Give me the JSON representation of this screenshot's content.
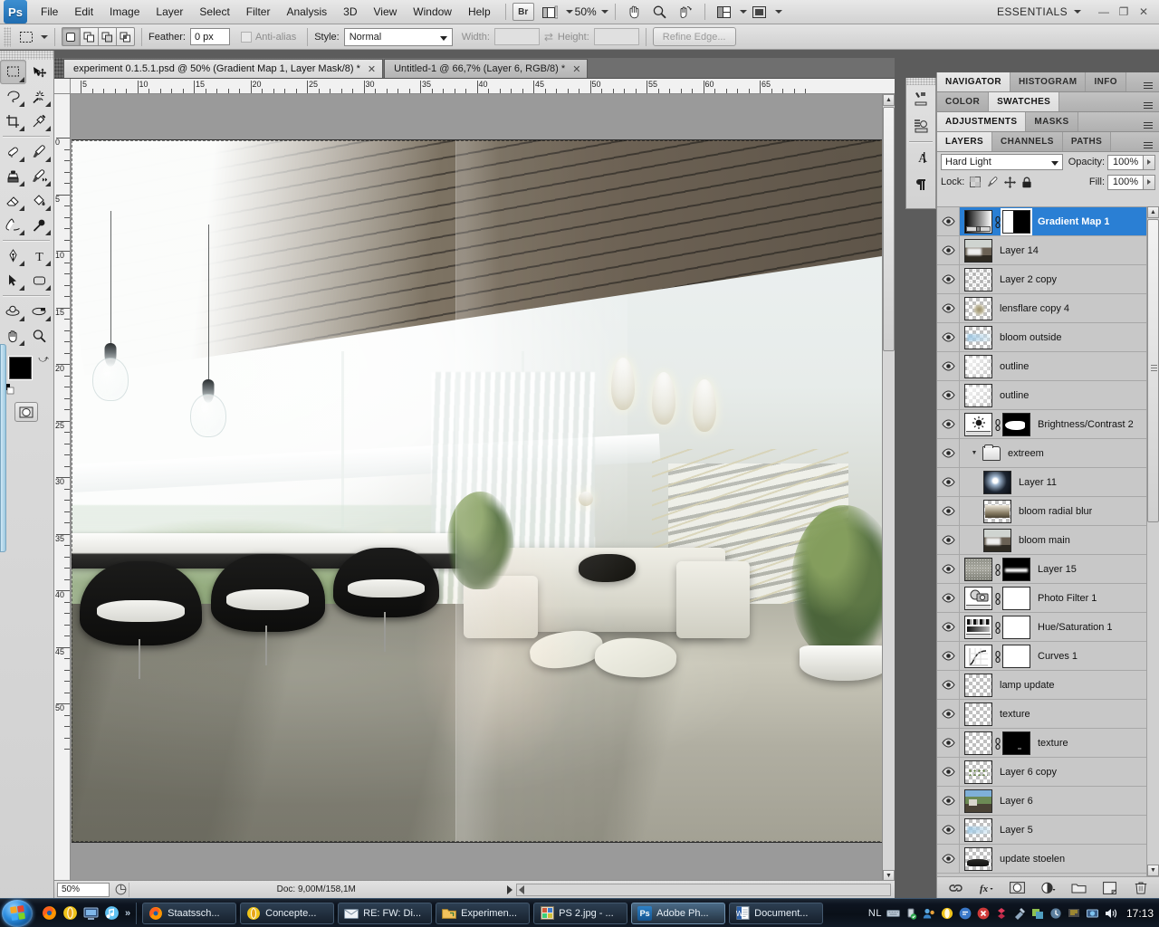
{
  "app": {
    "name": "Adobe Photoshop",
    "logo_text": "Ps",
    "workspace": "ESSENTIALS",
    "zoom_level": "50%"
  },
  "menubar": {
    "items": [
      "File",
      "Edit",
      "Image",
      "Layer",
      "Select",
      "Filter",
      "Analysis",
      "3D",
      "View",
      "Window",
      "Help"
    ],
    "bridge_label": "Br",
    "window_buttons": {
      "minimize": "—",
      "restore": "❐",
      "close": "✕"
    }
  },
  "options_bar": {
    "tool": "Rectangular Marquee Tool",
    "feather_label": "Feather:",
    "feather_value": "0 px",
    "antialias_label": "Anti-alias",
    "style_label": "Style:",
    "style_value": "Normal",
    "width_label": "Width:",
    "width_value": "",
    "height_label": "Height:",
    "height_value": "",
    "refine_edge_label": "Refine Edge..."
  },
  "toolbox": {
    "tools": [
      "rectangular-marquee",
      "move",
      "lasso",
      "magic-wand",
      "crop",
      "eyedropper",
      "spot-healing-brush",
      "brush",
      "clone-stamp",
      "history-brush",
      "eraser",
      "paint-bucket",
      "blur",
      "dodge",
      "pen",
      "type",
      "path-selection",
      "rectangle-shape",
      "rotate-3d-object",
      "rotate-3d-camera",
      "hand",
      "zoom"
    ],
    "foreground_color": "#000000",
    "background_color": "#ffffff"
  },
  "documents": {
    "tabs": [
      {
        "title": "experiment 0.1.5.1.psd @ 50% (Gradient Map 1, Layer Mask/8) *",
        "active": true
      },
      {
        "title": "Untitled-1 @ 66,7% (Layer 6, RGB/8) *",
        "active": false
      }
    ]
  },
  "rulers": {
    "unit": "cm",
    "horizontal_ticks": [
      "5",
      "10",
      "15",
      "20",
      "25",
      "30",
      "35",
      "40",
      "45",
      "50",
      "55",
      "60",
      "65"
    ],
    "vertical_ticks": [
      "0",
      "5",
      "10",
      "15",
      "20",
      "25",
      "30",
      "35",
      "40",
      "45",
      "50"
    ]
  },
  "status_bar": {
    "zoom_value": "50%",
    "doc_info": "Doc: 9,00M/158,1M"
  },
  "dock_strip": {
    "icons": [
      "brush-presets-icon",
      "tool-presets-icon",
      "character-icon",
      "paragraph-icon"
    ]
  },
  "panels": {
    "tab_rows": [
      {
        "tabs": [
          {
            "label": "NAVIGATOR",
            "active": true
          },
          {
            "label": "HISTOGRAM",
            "active": false
          },
          {
            "label": "INFO",
            "active": false
          }
        ]
      },
      {
        "tabs": [
          {
            "label": "COLOR",
            "active": false
          },
          {
            "label": "SWATCHES",
            "active": true
          }
        ]
      },
      {
        "tabs": [
          {
            "label": "ADJUSTMENTS",
            "active": true
          },
          {
            "label": "MASKS",
            "active": false
          }
        ]
      },
      {
        "tabs": [
          {
            "label": "LAYERS",
            "active": true
          },
          {
            "label": "CHANNELS",
            "active": false
          },
          {
            "label": "PATHS",
            "active": false
          }
        ]
      }
    ],
    "layers": {
      "blend_mode": "Hard Light",
      "opacity_label": "Opacity:",
      "opacity_value": "100%",
      "lock_label": "Lock:",
      "lock_icons": [
        "lock-transparent-pixels-icon",
        "lock-image-pixels-icon",
        "lock-position-icon",
        "lock-all-icon"
      ],
      "fill_label": "Fill:",
      "fill_value": "100%",
      "rows": [
        {
          "name": "Gradient Map 1",
          "selected": true,
          "visible": true,
          "type": "adjustment",
          "thumb": "gradient",
          "mask": "half-white-black",
          "linked": true,
          "indent": false
        },
        {
          "name": "Layer 14",
          "selected": false,
          "visible": true,
          "type": "pixel",
          "thumb": "photo-dark",
          "mask": null,
          "linked": false,
          "indent": false
        },
        {
          "name": "Layer 2 copy",
          "selected": false,
          "visible": true,
          "type": "pixel",
          "thumb": "transparent-specks",
          "mask": null,
          "linked": false,
          "indent": false
        },
        {
          "name": "lensflare copy 4",
          "selected": false,
          "visible": true,
          "type": "pixel",
          "thumb": "flare",
          "mask": null,
          "linked": false,
          "indent": false
        },
        {
          "name": "bloom outside",
          "selected": false,
          "visible": true,
          "type": "pixel",
          "thumb": "bloom-blue",
          "mask": null,
          "linked": false,
          "indent": false
        },
        {
          "name": "outline",
          "selected": false,
          "visible": true,
          "type": "pixel",
          "thumb": "faint",
          "mask": null,
          "linked": false,
          "indent": false
        },
        {
          "name": "outline",
          "selected": false,
          "visible": true,
          "type": "pixel",
          "thumb": "faint",
          "mask": null,
          "linked": false,
          "indent": false
        },
        {
          "name": "Brightness/Contrast 2",
          "selected": false,
          "visible": true,
          "type": "adjustment",
          "thumb": "brightness",
          "mask": "black-shape",
          "linked": true,
          "indent": false
        },
        {
          "name": "extreem",
          "selected": false,
          "visible": true,
          "type": "group",
          "thumb": "folder",
          "mask": null,
          "linked": false,
          "indent": false
        },
        {
          "name": "Layer 11",
          "selected": false,
          "visible": true,
          "type": "pixel",
          "thumb": "radial-glow",
          "mask": null,
          "linked": false,
          "indent": true
        },
        {
          "name": "bloom radial blur",
          "selected": false,
          "visible": true,
          "type": "pixel",
          "thumb": "bloom-photo",
          "mask": null,
          "linked": false,
          "indent": true
        },
        {
          "name": "bloom main",
          "selected": false,
          "visible": true,
          "type": "pixel",
          "thumb": "photo-dark",
          "mask": null,
          "linked": false,
          "indent": true
        },
        {
          "name": "Layer 15",
          "selected": false,
          "visible": true,
          "type": "pixel",
          "thumb": "grey-noise",
          "mask": "black-streak",
          "linked": true,
          "indent": false
        },
        {
          "name": "Photo Filter 1",
          "selected": false,
          "visible": true,
          "type": "adjustment",
          "thumb": "photo-filter",
          "mask": "white",
          "linked": true,
          "indent": false
        },
        {
          "name": "Hue/Saturation 1",
          "selected": false,
          "visible": true,
          "type": "adjustment",
          "thumb": "hue-sat",
          "mask": "white",
          "linked": true,
          "indent": false
        },
        {
          "name": "Curves 1",
          "selected": false,
          "visible": true,
          "type": "adjustment",
          "thumb": "curves",
          "mask": "white",
          "linked": true,
          "indent": false
        },
        {
          "name": "lamp update",
          "selected": false,
          "visible": true,
          "type": "pixel",
          "thumb": "transparent",
          "mask": null,
          "linked": false,
          "indent": false
        },
        {
          "name": "texture",
          "selected": false,
          "visible": true,
          "type": "pixel",
          "thumb": "transparent",
          "mask": null,
          "linked": false,
          "indent": false
        },
        {
          "name": "texture",
          "selected": false,
          "visible": true,
          "type": "pixel",
          "thumb": "transparent",
          "mask": "black",
          "linked": true,
          "indent": false
        },
        {
          "name": "Layer 6 copy",
          "selected": false,
          "visible": true,
          "type": "pixel",
          "thumb": "specks-green",
          "mask": null,
          "linked": false,
          "indent": false
        },
        {
          "name": "Layer 6",
          "selected": false,
          "visible": true,
          "type": "pixel",
          "thumb": "photo-scene",
          "mask": null,
          "linked": false,
          "indent": false
        },
        {
          "name": "Layer 5",
          "selected": false,
          "visible": true,
          "type": "pixel",
          "thumb": "bloom-blue",
          "mask": null,
          "linked": false,
          "indent": false
        },
        {
          "name": "update stoelen",
          "selected": false,
          "visible": true,
          "type": "pixel",
          "thumb": "chairs",
          "mask": null,
          "linked": false,
          "indent": false
        }
      ],
      "footer_icons": [
        "link-layers-icon",
        "add-layer-style-icon",
        "add-layer-mask-icon",
        "new-adjustment-layer-icon",
        "new-group-icon",
        "new-layer-icon",
        "delete-layer-icon"
      ]
    }
  },
  "taskbar": {
    "start_label": "Start",
    "quick_launch": [
      "firefox-icon",
      "opera-icon",
      "show-desktop-icon",
      "itunes-icon"
    ],
    "quick_launch_overflow": "»",
    "buttons": [
      {
        "label": "Staatssch...",
        "icon": "firefox-icon",
        "active": false
      },
      {
        "label": "Concepte...",
        "icon": "opera-icon",
        "active": false
      },
      {
        "label": "RE: FW: Di...",
        "icon": "mail-icon",
        "active": false
      },
      {
        "label": "Experimen...",
        "icon": "folder-icon",
        "active": false
      },
      {
        "label": "PS 2.jpg - ...",
        "icon": "image-icon",
        "active": false
      },
      {
        "label": "Adobe Ph...",
        "icon": "photoshop-icon",
        "active": true
      },
      {
        "label": "Document...",
        "icon": "word-icon",
        "active": false
      }
    ],
    "language": "NL",
    "tray_icons": [
      "handwriting-icon",
      "usb-icon",
      "network-people-icon",
      "opera-icon",
      "messenger-icon",
      "shield-alert-icon",
      "dropbox-icon",
      "tools-icon",
      "update-icon",
      "sync-icon",
      "security-icon",
      "network-icon",
      "volume-icon"
    ],
    "clock": "17:13"
  }
}
